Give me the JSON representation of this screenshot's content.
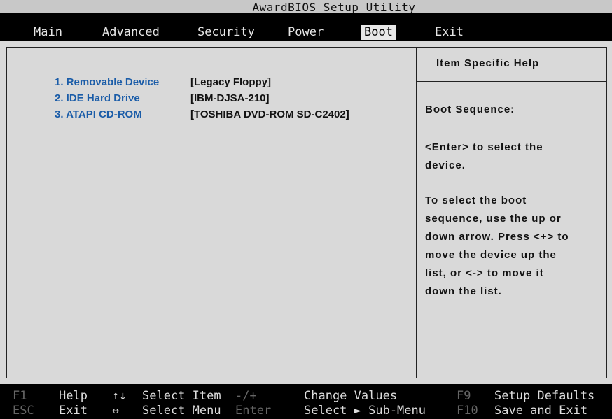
{
  "title": "AwardBIOS Setup Utility",
  "menu": {
    "items": [
      {
        "label": "Main"
      },
      {
        "label": "Advanced"
      },
      {
        "label": "Security"
      },
      {
        "label": "Power"
      },
      {
        "label": "Boot"
      },
      {
        "label": "Exit"
      }
    ],
    "active": "Boot"
  },
  "boot_devices": [
    {
      "name": "1. Removable Device",
      "value": "[Legacy Floppy]"
    },
    {
      "name": "2. IDE Hard Drive",
      "value": "[IBM-DJSA-210]"
    },
    {
      "name": "3. ATAPI CD-ROM",
      "value": "[TOSHIBA DVD-ROM SD-C2402]"
    }
  ],
  "help": {
    "title": "Item Specific Help",
    "lines": [
      "Boot Sequence:",
      "<Enter> to select the",
      "device.",
      "To select the boot",
      "sequence, use the up or",
      "down arrow. Press <+> to",
      "move the device up the",
      "list, or <-> to move it",
      "down the list."
    ]
  },
  "status_bar": {
    "f1_key": "F1",
    "f1_desc": "Help",
    "updown_key": "↑↓",
    "updown_desc": "Select Item",
    "plusminus_key": "-/+",
    "plusminus_desc": "Change Values",
    "f9_key": "F9",
    "f9_desc": "Setup Defaults",
    "esc_key": "ESC",
    "esc_desc": "Exit",
    "leftright_key": "↔",
    "leftright_desc": "Select Menu",
    "enter_key": "Enter",
    "enter_desc": "Select ► Sub-Menu",
    "f10_key": "F10",
    "f10_desc": "Save and Exit"
  },
  "colors": {
    "background": "#d9d9d9",
    "menu_bar": "#000000",
    "device_name": "#1a5ca8",
    "status_key": "#666666"
  }
}
